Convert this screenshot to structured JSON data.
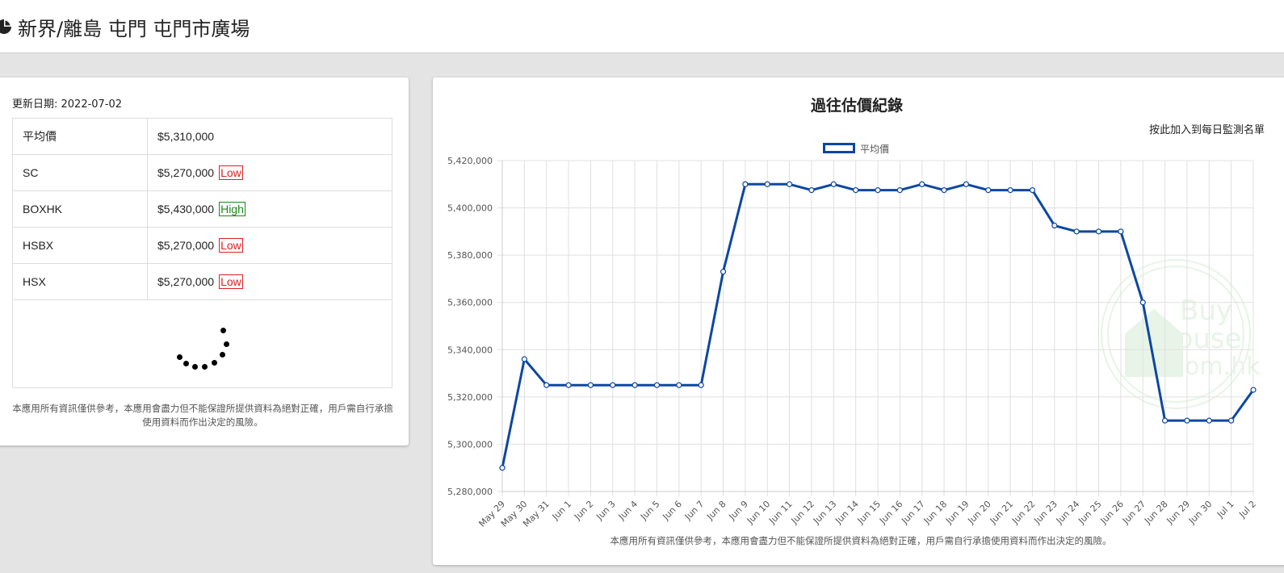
{
  "header": {
    "title": "新界/離島 屯門 屯門市廣場",
    "icon": "pie-chart-icon"
  },
  "summary": {
    "updated_label": "更新日期: 2022-07-02",
    "rows": [
      {
        "source": "平均價",
        "price": "$5,310,000",
        "badge": ""
      },
      {
        "source": "SC",
        "price": "$5,270,000",
        "badge": "Low"
      },
      {
        "source": "BOXHK",
        "price": "$5,430,000",
        "badge": "High"
      },
      {
        "source": "HSBX",
        "price": "$5,270,000",
        "badge": "Low"
      },
      {
        "source": "HSX",
        "price": "$5,270,000",
        "badge": "Low"
      }
    ],
    "disclaimer": "本應用所有資訊僅供參考，本應用會盡力但不能保證所提供資料為絕對正確，用戶需自行承擔使用資料而作出決定的風險。"
  },
  "chart_panel": {
    "watch_link": "按此加入到每日監測名單",
    "disclaimer": "本應用所有資訊僅供參考，本應用會盡力但不能保證所提供資料為絕對正確，用戶需自行承擔使用資料而作出決定的風險。"
  },
  "colors": {
    "line": "#0d47a1",
    "low": "#e02020",
    "high": "#1a8a1a"
  },
  "chart_data": {
    "type": "line",
    "title": "過往估價紀錄",
    "xlabel": "",
    "ylabel": "",
    "ylim": [
      5280000,
      5420000
    ],
    "yticks": [
      5280000,
      5300000,
      5320000,
      5340000,
      5360000,
      5380000,
      5400000,
      5420000
    ],
    "grid": true,
    "legend": "top-center",
    "categories": [
      "May 29",
      "May 30",
      "May 31",
      "Jun 1",
      "Jun 2",
      "Jun 3",
      "Jun 4",
      "Jun 5",
      "Jun 6",
      "Jun 7",
      "Jun 8",
      "Jun 9",
      "Jun 10",
      "Jun 11",
      "Jun 12",
      "Jun 13",
      "Jun 14",
      "Jun 15",
      "Jun 16",
      "Jun 17",
      "Jun 18",
      "Jun 19",
      "Jun 20",
      "Jun 21",
      "Jun 22",
      "Jun 23",
      "Jun 24",
      "Jun 25",
      "Jun 26",
      "Jun 27",
      "Jun 28",
      "Jun 29",
      "Jun 30",
      "Jul 1",
      "Jul 2"
    ],
    "series": [
      {
        "name": "平均價",
        "values": [
          5290000,
          5336000,
          5325000,
          5325000,
          5325000,
          5325000,
          5325000,
          5325000,
          5325000,
          5325000,
          5373000,
          5410000,
          5410000,
          5410000,
          5407500,
          5410000,
          5407500,
          5407500,
          5407500,
          5410000,
          5407500,
          5410000,
          5407500,
          5407500,
          5407500,
          5392500,
          5390000,
          5390000,
          5390000,
          5360000,
          5310000,
          5310000,
          5310000,
          5310000,
          5323000
        ]
      }
    ]
  }
}
